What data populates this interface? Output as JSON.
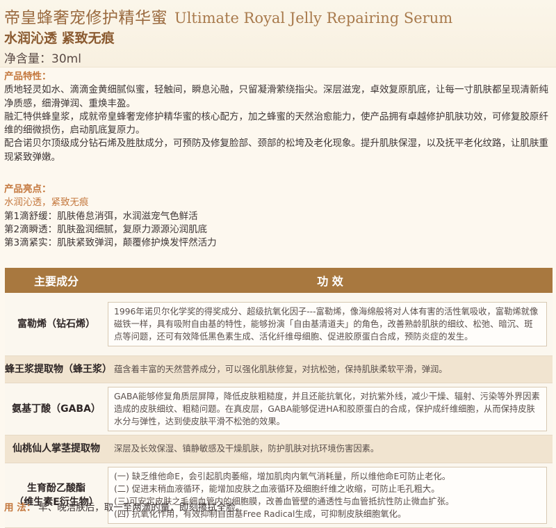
{
  "header": {
    "title_cn": "帝皇蜂奢宠修护精华蜜",
    "title_en": "Ultimate Royal Jelly Repairing Serum",
    "subtitle": "水润沁透  紧致无痕",
    "net_content": "净含量：30ml"
  },
  "features": {
    "title": "产品特性：",
    "p1": "质地轻灵如水、滴滴金黄细腻似蜜，轻触间，瞬息沁融，只留凝滑萦绕指尖。深层滋宠，卓效复原肌底，让每一寸肌肤都呈现清新纯净质感，细滑弹润、重焕丰盈。",
    "p2": "融汇特供蜂皇浆，成就帝皇蜂奢宠修护精华蜜的核心配方，加之蜂蜜的天然治愈能力，使产品拥有卓越修护肌肤功效，可修复胶原纤维的细微损伤，启动肌底复原力。",
    "p3": "配合诺贝尔顶级成分钻石烯及胜肽成分，可预防及修复脸部、颈部的松垮及老化现象。提升肌肤保湿，以及抚平老化纹路，让肌肤重现紧致弹嫩。"
  },
  "highlights": {
    "title": "产品亮点：",
    "subtitle": "水润沁透，紧致无痕",
    "items": [
      "第1滴舒缓：肌肤倦怠消弭，水润滋宠气色鲜活",
      "第2滴瞬透：肌肤盈润细腻，复原力源源沁润肌底",
      "第3滴紧实：肌肤紧致弹润，颠覆修护焕发怦然活力"
    ]
  },
  "table": {
    "col1": "主要成分",
    "col2": "功 效",
    "rows": [
      {
        "name": "富勒烯（钻石烯）",
        "effect": "1996年诺贝尔化学奖的得奖成分、超级抗氧化因子---富勒烯，像海绵般将对人体有害的活性氧吸收，富勒烯就像磁铁一样，具有吸附自由基的特性，能够扮演「自由基清道夫」的角色，改善熟龄肌肤的细纹、松弛、暗沉、斑点等问题，还可有效降低黑色素生成、活化纤维母细胞、促进胶原蛋白合成，预防炎症的发生。"
      },
      {
        "name": "蜂王浆提取物（蜂王浆）",
        "effect": "蕴含着丰富的天然营养成分，可以强化肌肤修复，对抗松弛，保持肌肤柔软平滑，弹润。"
      },
      {
        "name": "氨基丁酸（GABA）",
        "effect": "GABA能够修复角质层屏障，降低皮肤粗糙度，并且还能抗氧化，对抗紫外线，减少干燥、辐射、污染等外界因素造成的皮肤细纹、粗糙问题。在真皮层，GABA能够促进HA和胶原蛋白的合成，保护成纤维细胞，从而保持皮肤水分与弹性，达到使皮肤平滑不松弛的效果。"
      },
      {
        "name": "仙桃仙人掌茎提取物",
        "effect": "深层及长效保湿、镇静敏感及干燥肌肤，防护肌肤对抗环境伤害因素。"
      },
      {
        "name": "生育酚乙酸酯（维生素E衍生物）",
        "name_line1": "生育酚乙酸酯",
        "name_line2": "（维生素E衍生物）",
        "effect_lines": [
          "(一) 缺乏维他命E，会引起肌肉萎缩，增加肌肉内氧气消耗量，所以维他命E可防止老化。",
          "(二) 促进末稍血液循环，能增加皮肤之血液循环及细胞纤维之收缩，可防止毛孔粗大。",
          "(三)可安定皮肤之毛细血管内的细胞膜，改善血管壁的通透性与血管抵抗性防止微血扩张。",
          "(四) 抗氧化作用，有效抑制自由基Free  Radical生成，可抑制皮肤细胞氧化。"
        ]
      }
    ]
  },
  "usage": {
    "label": "用  法：",
    "text": "早、晚洁肤后，取一至两滴的量，即刻擦拭全脸。"
  }
}
